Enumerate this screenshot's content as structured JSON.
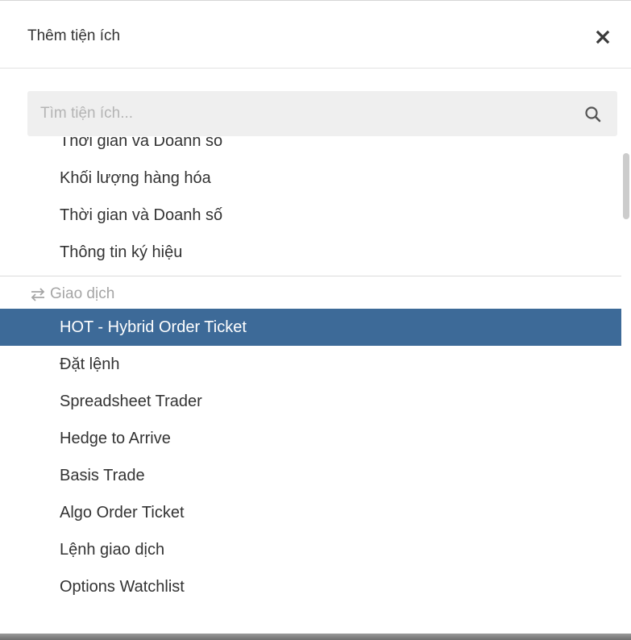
{
  "dialog": {
    "title": "Thêm tiện ích",
    "close_icon": "close-icon"
  },
  "search": {
    "placeholder": "Tìm tiện ích...",
    "value": "",
    "icon": "search-icon"
  },
  "list": {
    "items_before": [
      "Thời gian và Doanh số",
      "Khối lượng hàng hóa",
      "Thời gian và Doanh số",
      "Thông tin ký hiệu"
    ],
    "category": {
      "icon": "swap-arrows-icon",
      "label": "Giao dịch"
    },
    "items_after": [
      "HOT - Hybrid Order Ticket",
      "Đặt lệnh",
      "Spreadsheet Trader",
      "Hedge to Arrive",
      "Basis Trade",
      "Algo Order Ticket",
      "Lệnh giao dịch",
      "Options Watchlist"
    ],
    "selected_label": "HOT - Hybrid Order Ticket"
  },
  "colors": {
    "selected_bg": "#3d6a98",
    "selected_text": "#ffffff",
    "category_text": "#a5a5a5",
    "search_bg": "#efefef"
  }
}
